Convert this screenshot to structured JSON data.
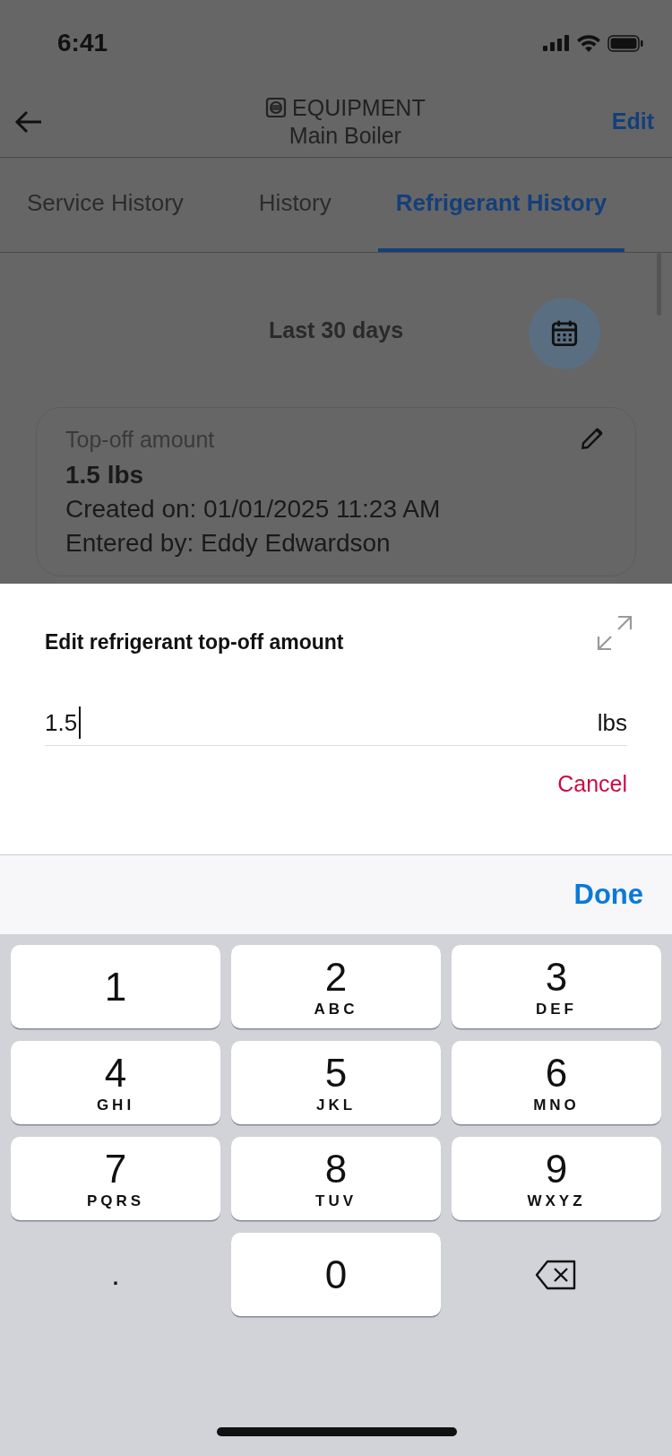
{
  "status_bar": {
    "time": "6:41"
  },
  "header": {
    "category": "EQUIPMENT",
    "title": "Main Boiler",
    "action": "Edit"
  },
  "tabs": [
    {
      "label": "Service History",
      "selected": false
    },
    {
      "label": "History",
      "selected": false
    },
    {
      "label": "Refrigerant History",
      "selected": true
    }
  ],
  "period": {
    "label": "Last 30 days"
  },
  "record": {
    "label": "Top-off amount",
    "amount": "1.5 lbs",
    "created": "Created on: 01/01/2025  11:23 AM",
    "entered": "Entered by: Eddy Edwardson"
  },
  "sheet": {
    "title": "Edit refrigerant top-off amount",
    "value": "1.5",
    "unit": "lbs",
    "cancel": "Cancel"
  },
  "keyboard_bar": {
    "done": "Done"
  },
  "keys": [
    {
      "kind": "digit",
      "digit": "1"
    },
    {
      "kind": "digit",
      "digit": "2",
      "letters": "ABC"
    },
    {
      "kind": "digit",
      "digit": "3",
      "letters": "DEF"
    },
    {
      "kind": "digit",
      "digit": "4",
      "letters": "GHI"
    },
    {
      "kind": "digit",
      "digit": "5",
      "letters": "JKL"
    },
    {
      "kind": "digit",
      "digit": "6",
      "letters": "MNO"
    },
    {
      "kind": "digit",
      "digit": "7",
      "letters": "PQRS"
    },
    {
      "kind": "digit",
      "digit": "8",
      "letters": "TUV"
    },
    {
      "kind": "digit",
      "digit": "9",
      "letters": "WXYZ"
    },
    {
      "kind": "dot",
      "digit": "."
    },
    {
      "kind": "digit",
      "digit": "0"
    },
    {
      "kind": "delete"
    }
  ]
}
